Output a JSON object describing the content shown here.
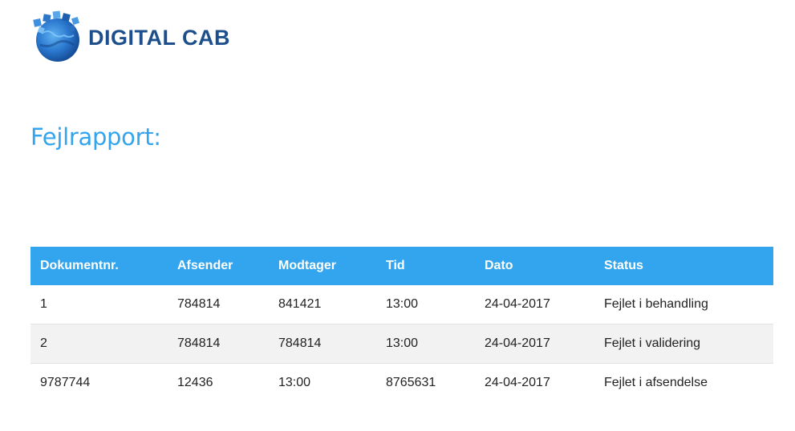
{
  "logo": {
    "text": "DIGITAL CAB",
    "icon": "globe-puzzle-icon",
    "colors": {
      "text": "#1c4f8c",
      "globe": "#2e7dd1"
    }
  },
  "page_title": "Fejlrapport:",
  "colors": {
    "accent": "#33a4ee",
    "row_alt": "#f2f2f2"
  },
  "table": {
    "headers": [
      "Dokumentnr.",
      "Afsender",
      "Modtager",
      "Tid",
      "Dato",
      "Status"
    ],
    "rows": [
      [
        "1",
        "784814",
        "841421",
        "13:00",
        "24-04-2017",
        "Fejlet i behandling"
      ],
      [
        "2",
        "784814",
        "784814",
        "13:00",
        "24-04-2017",
        "Fejlet i validering"
      ],
      [
        "9787744",
        "12436",
        "13:00",
        "8765631",
        "24-04-2017",
        "Fejlet i afsendelse"
      ]
    ]
  }
}
